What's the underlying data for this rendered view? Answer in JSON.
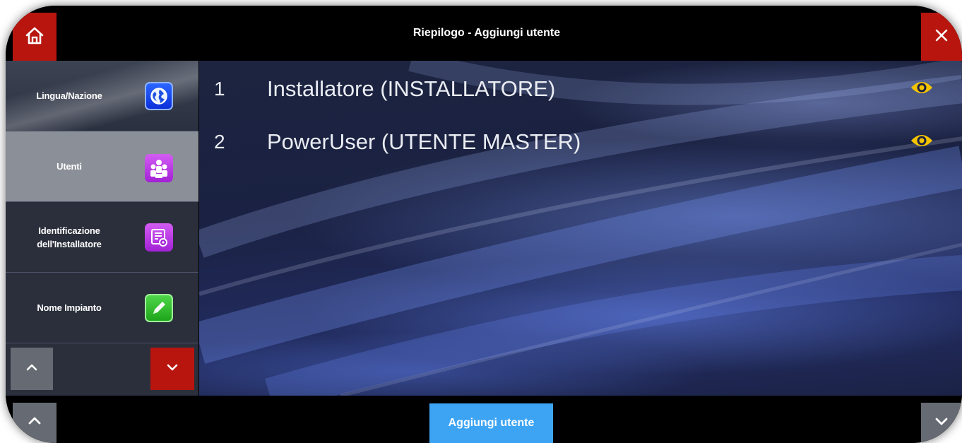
{
  "header": {
    "title": "Riepilogo - Aggiungi utente",
    "home_icon": "home-icon",
    "close_icon": "close-icon"
  },
  "sidebar": {
    "items": [
      {
        "label_lines": [
          "Lingua/Nazione"
        ],
        "icon": "globe-icon",
        "active": false
      },
      {
        "label_lines": [
          "Utenti"
        ],
        "icon": "users-icon",
        "active": true
      },
      {
        "label_lines": [
          "Identificazione",
          "dell'Installatore"
        ],
        "icon": "installer-id-icon",
        "active": false
      },
      {
        "label_lines": [
          "Nome Impianto"
        ],
        "icon": "edit-icon",
        "active": false
      }
    ],
    "scroll_up_icon": "chevron-up-icon",
    "scroll_down_icon": "chevron-down-icon"
  },
  "users": [
    {
      "number": "1",
      "name": "Installatore (INSTALLATORE)",
      "action_icon": "eye-icon"
    },
    {
      "number": "2",
      "name": "PowerUser (UTENTE MASTER)",
      "action_icon": "eye-icon"
    }
  ],
  "footer": {
    "add_label": "Aggiungi utente",
    "page_up_icon": "chevron-up-icon",
    "page_down_icon": "chevron-down-icon"
  },
  "colors": {
    "accent_red": "#b8150f",
    "accent_blue": "#3da4f3",
    "eye_yellow": "#f5c400",
    "sidebar_active": "#8b8f97",
    "sidebar_bg": "#2b2f3b"
  }
}
